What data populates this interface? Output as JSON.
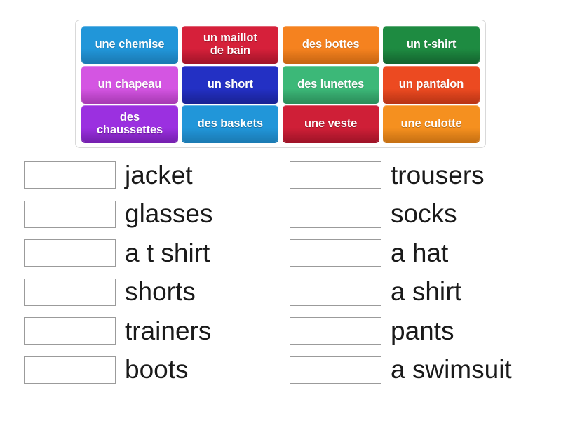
{
  "wordbank": {
    "name": "word-bank",
    "rows": [
      [
        {
          "label": "une chemise",
          "color": "#2196d9",
          "shadow": "#1b7bb4"
        },
        {
          "label": "un maillot\nde bain",
          "color": "#d6203a",
          "shadow": "#a4152a"
        },
        {
          "label": "des bottes",
          "color": "#f5821f",
          "shadow": "#c96713"
        },
        {
          "label": "un t-shirt",
          "color": "#1e8b41",
          "shadow": "#156630"
        }
      ],
      [
        {
          "label": "un chapeau",
          "color": "#d455e2",
          "shadow": "#a93bb5"
        },
        {
          "label": "un short",
          "color": "#2330c4",
          "shadow": "#1a2396"
        },
        {
          "label": "des lunettes",
          "color": "#3cb878",
          "shadow": "#2c8e5b"
        },
        {
          "label": "un pantalon",
          "color": "#ec4a21",
          "shadow": "#bb3616"
        }
      ],
      [
        {
          "label": "des\nchaussettes",
          "color": "#9b30e0",
          "shadow": "#7620b0"
        },
        {
          "label": "des baskets",
          "color": "#2196d9",
          "shadow": "#1b7bb4"
        },
        {
          "label": "une veste",
          "color": "#cf1f37",
          "shadow": "#a01428"
        },
        {
          "label": "une culotte",
          "color": "#f5901f",
          "shadow": "#c77113"
        }
      ]
    ]
  },
  "answers": {
    "left": [
      {
        "label": "jacket",
        "value": ""
      },
      {
        "label": "glasses",
        "value": ""
      },
      {
        "label": "a t shirt",
        "value": ""
      },
      {
        "label": "shorts",
        "value": ""
      },
      {
        "label": "trainers",
        "value": ""
      },
      {
        "label": "boots",
        "value": ""
      }
    ],
    "right": [
      {
        "label": "trousers",
        "value": ""
      },
      {
        "label": "socks",
        "value": ""
      },
      {
        "label": "a hat",
        "value": ""
      },
      {
        "label": "a shirt",
        "value": ""
      },
      {
        "label": "pants",
        "value": ""
      },
      {
        "label": "a swimsuit",
        "value": ""
      }
    ]
  }
}
